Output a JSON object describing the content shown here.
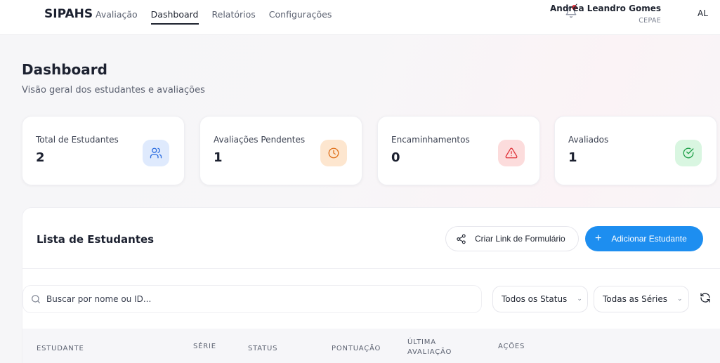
{
  "header": {
    "brand": "SIPAHS",
    "nav": [
      "Avaliação",
      "Dashboard",
      "Relatórios",
      "Configurações"
    ],
    "active_nav": "Dashboard",
    "user_name": "Andréa Leandro Gomes",
    "user_org": "CEPAE",
    "avatar_initials": "AL",
    "icons": {
      "notifications": "bell-icon"
    }
  },
  "page": {
    "title": "Dashboard",
    "subtitle": "Visão geral dos estudantes e avaliações"
  },
  "stats": [
    {
      "label": "Total de Estudantes",
      "value": "2",
      "icon": "users-icon",
      "color": "#2f6fe0",
      "bg": "#dfeafd"
    },
    {
      "label": "Avaliações Pendentes",
      "value": "1",
      "icon": "clock-icon",
      "color": "#e0731f",
      "bg": "#fde6cf"
    },
    {
      "label": "Encaminhamentos",
      "value": "0",
      "icon": "alert-triangle-icon",
      "color": "#e0383e",
      "bg": "#fcdcdc"
    },
    {
      "label": "Avaliados",
      "value": "1",
      "icon": "check-circle-icon",
      "color": "#21a14b",
      "bg": "#d9f6e1"
    }
  ],
  "students": {
    "title": "Lista de Estudantes",
    "link_button": "Criar Link de Formulário",
    "add_button": "Adicionar Estudante",
    "add_button_color": "#1d8ef0",
    "search_placeholder": "Buscar por nome ou ID...",
    "status_filter": "Todos os Status",
    "series_filter": "Todas as Séries",
    "columns": [
      "Estudante",
      "Série",
      "Status",
      "Pontuação",
      "Última Avaliação",
      "Ações"
    ]
  }
}
